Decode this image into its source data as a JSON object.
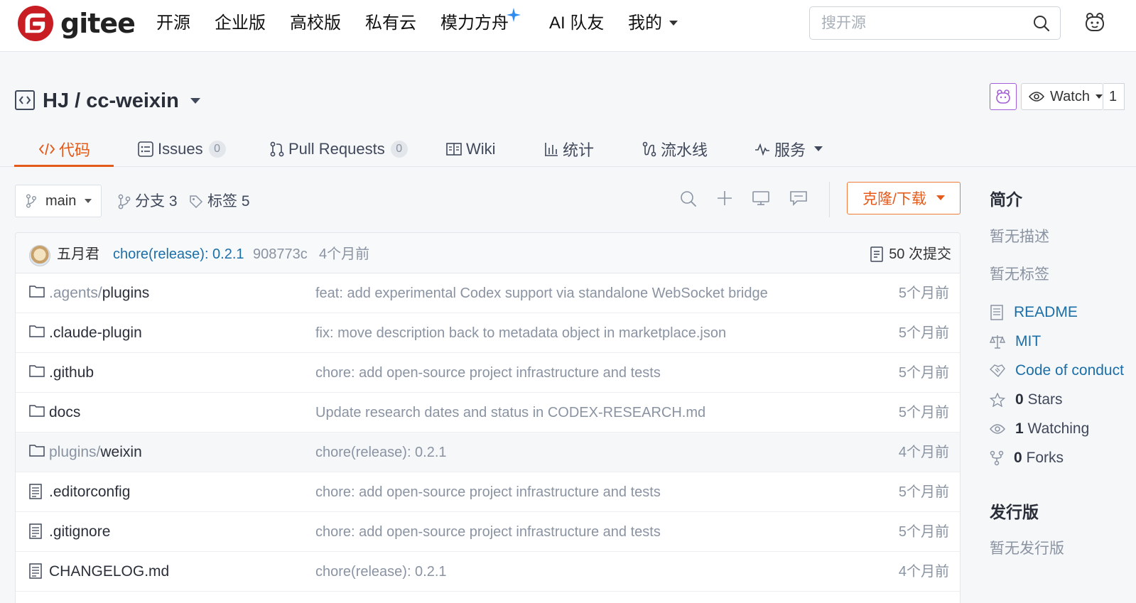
{
  "brand": {
    "name": "gitee",
    "logo_letter": "G",
    "logo_color": "#c71d23"
  },
  "nav": {
    "items": [
      {
        "label": "开源"
      },
      {
        "label": "企业版"
      },
      {
        "label": "高校版"
      },
      {
        "label": "私有云"
      },
      {
        "label": "模力方舟"
      },
      {
        "label": "AI 队友"
      },
      {
        "label": "我的"
      }
    ],
    "search_placeholder": "搜开源"
  },
  "repo": {
    "title": "HJ / cc-weixin",
    "watch_label": "Watch",
    "watch_count": "1",
    "tabs": [
      {
        "label": "代码",
        "icon": "code-icon",
        "active": true
      },
      {
        "label": "Issues",
        "icon": "issues-icon",
        "badge": "0"
      },
      {
        "label": "Pull Requests",
        "icon": "pull-request-icon",
        "badge": "0"
      },
      {
        "label": "Wiki",
        "icon": "book-icon"
      },
      {
        "label": "统计",
        "icon": "stats-icon"
      },
      {
        "label": "流水线",
        "icon": "pipeline-icon"
      },
      {
        "label": "服务",
        "icon": "pulse-icon"
      }
    ]
  },
  "toolbar": {
    "branch": "main",
    "branches_label": "分支 3",
    "tags_label": "标签 5",
    "clone_label": "克隆/下载",
    "accent_color": "#e35a1b"
  },
  "latest_commit": {
    "author": "五月君",
    "message": "chore(release): 0.2.1",
    "sha": "908773c",
    "time": "4个月前",
    "count_label": "50 次提交"
  },
  "files": [
    {
      "type": "folder",
      "prefix": ".agents/",
      "name": "plugins",
      "commit": "feat: add experimental Codex support via standalone WebSocket bridge",
      "time": "5个月前"
    },
    {
      "type": "folder",
      "prefix": "",
      "name": ".claude-plugin",
      "commit": "fix: move description back to metadata object in marketplace.json",
      "time": "5个月前"
    },
    {
      "type": "folder",
      "prefix": "",
      "name": ".github",
      "commit": "chore: add open-source project infrastructure and tests",
      "time": "5个月前"
    },
    {
      "type": "folder",
      "prefix": "",
      "name": "docs",
      "commit": "Update research dates and status in CODEX-RESEARCH.md",
      "time": "5个月前"
    },
    {
      "type": "folder",
      "prefix": "plugins/",
      "name": "weixin",
      "commit": "chore(release): 0.2.1",
      "time": "4个月前"
    },
    {
      "type": "file",
      "prefix": "",
      "name": ".editorconfig",
      "commit": "chore: add open-source project infrastructure and tests",
      "time": "5个月前"
    },
    {
      "type": "file",
      "prefix": "",
      "name": ".gitignore",
      "commit": "chore: add open-source project infrastructure and tests",
      "time": "5个月前"
    },
    {
      "type": "file",
      "prefix": "",
      "name": "CHANGELOG.md",
      "commit": "chore(release): 0.2.1",
      "time": "4个月前"
    }
  ],
  "sidebar": {
    "intro_title": "简介",
    "no_description": "暂无描述",
    "no_tags": "暂无标签",
    "readme": "README",
    "license": "MIT",
    "code_of_conduct": "Code of conduct",
    "stars_count": "0",
    "stars_label": "Stars",
    "watching_count": "1",
    "watching_label": "Watching",
    "forks_count": "0",
    "forks_label": "Forks",
    "releases_title": "发行版",
    "no_releases": "暂无发行版"
  }
}
